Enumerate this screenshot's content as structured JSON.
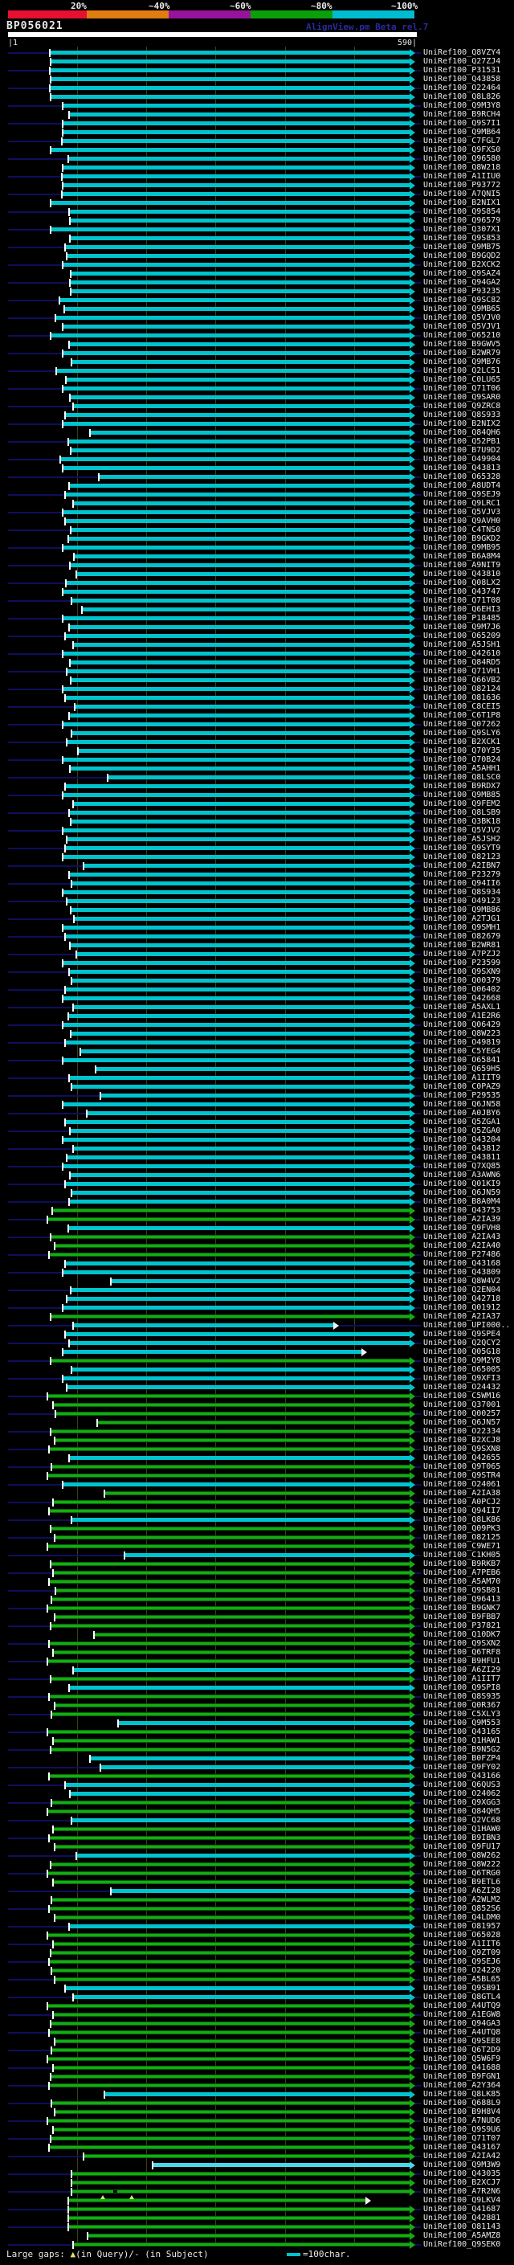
{
  "header": {
    "title": "BP056021",
    "watermark": "AlignView.pm Beta rel.7",
    "scale_labels": [
      "20%",
      "~40%",
      "~60%",
      "~80%",
      "~100%"
    ],
    "scale_colors": [
      "#e8102f",
      "#e07c10",
      "#96149b",
      "#0aa00a",
      "#00bcd0"
    ],
    "ruler_left": "|1",
    "ruler_right": "590|"
  },
  "footer": {
    "gaps_label": "Large gaps: ",
    "query_gap_symbol": "▲",
    "gaps_detail": "(in Query)/- (in Subject)",
    "scale_legend": "=100char."
  },
  "colors": {
    "cyan": "#00c3cd",
    "light_cyan": "#49d8e8",
    "green": "#14ac14",
    "green_edge": "#046504",
    "navy": "#0e0e5e",
    "grid": "#3d3d14",
    "label": "#e8e8e8",
    "yellow": "#e8e060"
  },
  "chart_data": {
    "type": "bar",
    "title": "Protein hit alignment overview for query BP056021",
    "orientation": "horizontal",
    "x_axis": {
      "label": "query position",
      "min": 1,
      "max": 590,
      "gridline_interval": 100,
      "unit": "char"
    },
    "query_length": 590,
    "identity_legend": {
      "20%": "red",
      "~40%": "orange",
      "~60%": "purple",
      "~80%": "green",
      "~100%": "cyan"
    },
    "row_format": [
      "accession",
      "color(c=cyan ~100%,g=green ~80%,C=light cyan)",
      "align_start",
      "align_end(optional,default 590)",
      "arrow(optional,o=open)"
    ],
    "rows": [
      [
        "UniRef100_Q8VZY4",
        "c",
        61
      ],
      [
        "UniRef100_Q27ZJ4",
        "c",
        62
      ],
      [
        "UniRef100_P31531",
        "c",
        61
      ],
      [
        "UniRef100_Q43858",
        "c",
        62
      ],
      [
        "UniRef100_O22464",
        "c",
        61
      ],
      [
        "UniRef100_Q8L826",
        "c",
        62
      ],
      [
        "UniRef100_Q9M3Y8",
        "c",
        80
      ],
      [
        "UniRef100_B9RCH4",
        "c",
        89
      ],
      [
        "UniRef100_Q9S7I1",
        "c",
        80
      ],
      [
        "UniRef100_Q9MB64",
        "c",
        80
      ],
      [
        "UniRef100_C7FGL7",
        "c",
        79
      ],
      [
        "UniRef100_Q9FXS0",
        "c",
        62
      ],
      [
        "UniRef100_Q96580",
        "c",
        88
      ],
      [
        "UniRef100_Q8W218",
        "c",
        80
      ],
      [
        "UniRef100_A1IIU0",
        "c",
        79
      ],
      [
        "UniRef100_P93772",
        "c",
        80
      ],
      [
        "UniRef100_A7QNI5",
        "c",
        79
      ],
      [
        "UniRef100_B2NIX1",
        "c",
        63
      ],
      [
        "UniRef100_Q9S854",
        "c",
        89
      ],
      [
        "UniRef100_Q96579",
        "c",
        90
      ],
      [
        "UniRef100_Q307X1",
        "c",
        62
      ],
      [
        "UniRef100_Q9S853",
        "c",
        91
      ],
      [
        "UniRef100_Q9MB75",
        "c",
        84
      ],
      [
        "UniRef100_B9GQD2",
        "c",
        86
      ],
      [
        "UniRef100_B2XCK2",
        "c",
        80
      ],
      [
        "UniRef100_Q9SAZ4",
        "c",
        92
      ],
      [
        "UniRef100_Q94GA2",
        "c",
        91
      ],
      [
        "UniRef100_P93235",
        "c",
        92
      ],
      [
        "UniRef100_Q9SC82",
        "c",
        75
      ],
      [
        "UniRef100_Q9MB65",
        "c",
        82
      ],
      [
        "UniRef100_Q5VJV0",
        "c",
        69
      ],
      [
        "UniRef100_Q5VJV1",
        "c",
        80
      ],
      [
        "UniRef100_O65210",
        "c",
        62
      ],
      [
        "UniRef100_B9GWV5",
        "c",
        89
      ],
      [
        "UniRef100_B2WR79",
        "c",
        80
      ],
      [
        "UniRef100_Q9MB76",
        "c",
        93
      ],
      [
        "UniRef100_Q2LC51",
        "c",
        71
      ],
      [
        "UniRef100_C0LU65",
        "c",
        85
      ],
      [
        "UniRef100_Q71T06",
        "c",
        80
      ],
      [
        "UniRef100_Q9SAR0",
        "c",
        90
      ],
      [
        "UniRef100_Q9ZRC8",
        "c",
        95
      ],
      [
        "UniRef100_Q8S933",
        "c",
        84
      ],
      [
        "UniRef100_B2NIX2",
        "c",
        80
      ],
      [
        "UniRef100_Q84QH6",
        "c",
        120
      ],
      [
        "UniRef100_Q52PB1",
        "c",
        88
      ],
      [
        "UniRef100_B7U9D2",
        "c",
        92
      ],
      [
        "UniRef100_O49904",
        "c",
        76
      ],
      [
        "UniRef100_Q43813",
        "c",
        80
      ],
      [
        "UniRef100_O65328",
        "c",
        132
      ],
      [
        "UniRef100_A8UDT4",
        "c",
        89
      ],
      [
        "UniRef100_Q9SEJ9",
        "c",
        84
      ],
      [
        "UniRef100_Q9LRC1",
        "c",
        95
      ],
      [
        "UniRef100_Q5VJV3",
        "c",
        80
      ],
      [
        "UniRef100_Q9AVH0",
        "c",
        84
      ],
      [
        "UniRef100_C4TNS0",
        "c",
        92
      ],
      [
        "UniRef100_B9GKD2",
        "c",
        88
      ],
      [
        "UniRef100_Q9MB95",
        "c",
        80
      ],
      [
        "UniRef100_B6A8M4",
        "c",
        96
      ],
      [
        "UniRef100_A9NIT9",
        "c",
        90
      ],
      [
        "UniRef100_Q43810",
        "c",
        100
      ],
      [
        "UniRef100_Q08LX2",
        "c",
        85
      ],
      [
        "UniRef100_Q43747",
        "c",
        80
      ],
      [
        "UniRef100_Q71T08",
        "c",
        93
      ],
      [
        "UniRef100_Q6EHI3",
        "c",
        108
      ],
      [
        "UniRef100_P18485",
        "c",
        80
      ],
      [
        "UniRef100_Q9M7J6",
        "c",
        89
      ],
      [
        "UniRef100_O65209",
        "c",
        84
      ],
      [
        "UniRef100_A5JSH1",
        "c",
        95
      ],
      [
        "UniRef100_Q42610",
        "c",
        80
      ],
      [
        "UniRef100_Q84RD5",
        "c",
        90
      ],
      [
        "UniRef100_Q71VH1",
        "c",
        86
      ],
      [
        "UniRef100_Q66VB2",
        "c",
        92
      ],
      [
        "UniRef100_O82124",
        "c",
        80
      ],
      [
        "UniRef100_O81636",
        "c",
        84
      ],
      [
        "UniRef100_C8CEI5",
        "c",
        98
      ],
      [
        "UniRef100_C6T1P8",
        "c",
        89
      ],
      [
        "UniRef100_Q07262",
        "c",
        80
      ],
      [
        "UniRef100_Q9SLY6",
        "c",
        93
      ],
      [
        "UniRef100_B2XCK1",
        "c",
        86
      ],
      [
        "UniRef100_Q70Y35",
        "c",
        102
      ],
      [
        "UniRef100_Q70B24",
        "c",
        80
      ],
      [
        "UniRef100_A5AHH1",
        "c",
        90
      ],
      [
        "UniRef100_Q8LSC0",
        "c",
        145
      ],
      [
        "UniRef100_B9RDX7",
        "c",
        84
      ],
      [
        "UniRef100_Q9MB85",
        "c",
        80
      ],
      [
        "UniRef100_Q9FEM2",
        "c",
        95
      ],
      [
        "UniRef100_Q8LSB9",
        "c",
        89
      ],
      [
        "UniRef100_Q3BK18",
        "c",
        92
      ],
      [
        "UniRef100_Q5VJV2",
        "c",
        80
      ],
      [
        "UniRef100_A5JSH2",
        "c",
        86
      ],
      [
        "UniRef100_Q9SYT9",
        "c",
        84
      ],
      [
        "UniRef100_O82123",
        "c",
        80
      ],
      [
        "UniRef100_A2IBN7",
        "c",
        110
      ],
      [
        "UniRef100_P23279",
        "c",
        89
      ],
      [
        "UniRef100_Q94II6",
        "c",
        93
      ],
      [
        "UniRef100_Q8S934",
        "c",
        80
      ],
      [
        "UniRef100_O49123",
        "c",
        86
      ],
      [
        "UniRef100_Q9MB86",
        "c",
        92
      ],
      [
        "UniRef100_A2TJG1",
        "c",
        96
      ],
      [
        "UniRef100_Q9SMH1",
        "c",
        80
      ],
      [
        "UniRef100_O82679",
        "c",
        84
      ],
      [
        "UniRef100_B2WR81",
        "c",
        90
      ],
      [
        "UniRef100_A7PZJ2",
        "c",
        100
      ],
      [
        "UniRef100_P23599",
        "c",
        80
      ],
      [
        "UniRef100_Q9SXN9",
        "c",
        89
      ],
      [
        "UniRef100_Q00379",
        "c",
        93
      ],
      [
        "UniRef100_Q06402",
        "c",
        84
      ],
      [
        "UniRef100_Q42668",
        "c",
        80
      ],
      [
        "UniRef100_A5AXL1",
        "c",
        95
      ],
      [
        "UniRef100_A1E2R6",
        "c",
        88
      ],
      [
        "UniRef100_Q06429",
        "c",
        80
      ],
      [
        "UniRef100_Q8W223",
        "c",
        92
      ],
      [
        "UniRef100_O49819",
        "c",
        84
      ],
      [
        "UniRef100_C5YEG4",
        "c",
        105
      ],
      [
        "UniRef100_O65841",
        "c",
        80
      ],
      [
        "UniRef100_Q659H5",
        "c",
        128
      ],
      [
        "UniRef100_A1IIT9",
        "c",
        89
      ],
      [
        "UniRef100_C0PAZ9",
        "c",
        93
      ],
      [
        "UniRef100_P29535",
        "c",
        135
      ],
      [
        "UniRef100_Q6JN58",
        "c",
        80
      ],
      [
        "UniRef100_A0JBY6",
        "c",
        115
      ],
      [
        "UniRef100_Q5ZGA1",
        "c",
        84
      ],
      [
        "UniRef100_Q5ZGA0",
        "c",
        90
      ],
      [
        "UniRef100_Q43204",
        "c",
        80
      ],
      [
        "UniRef100_Q43812",
        "c",
        95
      ],
      [
        "UniRef100_Q43811",
        "c",
        86
      ],
      [
        "UniRef100_Q7XQ85",
        "c",
        80
      ],
      [
        "UniRef100_A3AWN6",
        "c",
        90
      ],
      [
        "UniRef100_Q01KI9",
        "c",
        84
      ],
      [
        "UniRef100_Q6JN59",
        "c",
        93
      ],
      [
        "UniRef100_B8A0M4",
        "c",
        89
      ],
      [
        "UniRef100_Q43753",
        "g",
        65
      ],
      [
        "UniRef100_A2IA39",
        "g",
        58
      ],
      [
        "UniRef100_Q9FVH8",
        "c",
        88
      ],
      [
        "UniRef100_A2IA43",
        "g",
        62
      ],
      [
        "UniRef100_A2IA40",
        "g",
        68
      ],
      [
        "UniRef100_P27486",
        "g",
        60
      ],
      [
        "UniRef100_Q43168",
        "c",
        84
      ],
      [
        "UniRef100_Q43809",
        "c",
        80
      ],
      [
        "UniRef100_Q8W4V2",
        "c",
        150
      ],
      [
        "UniRef100_Q2EN04",
        "c",
        92
      ],
      [
        "UniRef100_Q42718",
        "c",
        86
      ],
      [
        "UniRef100_Q01912",
        "c",
        80
      ],
      [
        "UniRef100_A2IA37",
        "g",
        63
      ],
      [
        "UniRef100_UPI000..",
        "c",
        95,
        480,
        "o"
      ],
      [
        "UniRef100_Q9SPE4",
        "c",
        84
      ],
      [
        "UniRef100_Q2QCY2",
        "c",
        89
      ],
      [
        "UniRef100_Q05G18",
        "c",
        80,
        520,
        "o"
      ],
      [
        "UniRef100_Q9M2Y8",
        "g",
        62
      ],
      [
        "UniRef100_O65005",
        "c",
        93
      ],
      [
        "UniRef100_Q9XFI3",
        "c",
        80
      ],
      [
        "UniRef100_O24432",
        "c",
        86
      ],
      [
        "UniRef100_C5WM16",
        "g",
        58
      ],
      [
        "UniRef100_Q37001",
        "g",
        66
      ],
      [
        "UniRef100_Q00257",
        "g",
        70
      ],
      [
        "UniRef100_Q6JN57",
        "g",
        130
      ],
      [
        "UniRef100_O22334",
        "g",
        62
      ],
      [
        "UniRef100_B2XCJ8",
        "g",
        68
      ],
      [
        "UniRef100_Q9SXN8",
        "g",
        60
      ],
      [
        "UniRef100_Q42655",
        "c",
        89
      ],
      [
        "UniRef100_Q9T065",
        "g",
        64
      ],
      [
        "UniRef100_Q9STR4",
        "g",
        58
      ],
      [
        "UniRef100_O24061",
        "c",
        80
      ],
      [
        "UniRef100_A2IA38",
        "g",
        140
      ],
      [
        "UniRef100_A0PCJ2",
        "g",
        66
      ],
      [
        "UniRef100_Q94II7",
        "g",
        60
      ],
      [
        "UniRef100_Q8LK86",
        "c",
        93
      ],
      [
        "UniRef100_Q09PK3",
        "g",
        63
      ],
      [
        "UniRef100_O82125",
        "g",
        68
      ],
      [
        "UniRef100_C9WE71",
        "g",
        58
      ],
      [
        "UniRef100_C1KH05",
        "c",
        170
      ],
      [
        "UniRef100_B9RKB7",
        "g",
        62
      ],
      [
        "UniRef100_A7PEB6",
        "g",
        66
      ],
      [
        "UniRef100_A5AM70",
        "g",
        60
      ],
      [
        "UniRef100_Q9SB01",
        "g",
        70
      ],
      [
        "UniRef100_Q96413",
        "g",
        64
      ],
      [
        "UniRef100_B9GNK7",
        "g",
        58
      ],
      [
        "UniRef100_B9FBB7",
        "g",
        68
      ],
      [
        "UniRef100_P37821",
        "g",
        62
      ],
      [
        "UniRef100_Q10DK7",
        "g",
        125
      ],
      [
        "UniRef100_Q9SXN2",
        "g",
        60
      ],
      [
        "UniRef100_Q6TRF8",
        "g",
        66
      ],
      [
        "UniRef100_B9HFU1",
        "g",
        58
      ],
      [
        "UniRef100_A6ZI29",
        "c",
        95
      ],
      [
        "UniRef100_A1IIT7",
        "g",
        63
      ],
      [
        "UniRef100_Q9SPI8",
        "c",
        89
      ],
      [
        "UniRef100_Q8S935",
        "g",
        60
      ],
      [
        "UniRef100_Q0R367",
        "g",
        68
      ],
      [
        "UniRef100_C5XLY3",
        "g",
        64
      ],
      [
        "UniRef100_Q9M553",
        "c",
        160
      ],
      [
        "UniRef100_Q43165",
        "g",
        58
      ],
      [
        "UniRef100_Q1HAW1",
        "g",
        66
      ],
      [
        "UniRef100_B9N5G2",
        "g",
        62
      ],
      [
        "UniRef100_B0FZP4",
        "c",
        120
      ],
      [
        "UniRef100_Q9FY02",
        "c",
        135
      ],
      [
        "UniRef100_Q43166",
        "g",
        60
      ],
      [
        "UniRef100_Q6QUS3",
        "c",
        84
      ],
      [
        "UniRef100_O24062",
        "c",
        90
      ],
      [
        "UniRef100_Q9XGG3",
        "g",
        64
      ],
      [
        "UniRef100_Q84QH5",
        "g",
        58
      ],
      [
        "UniRef100_Q2VC68",
        "c",
        93
      ],
      [
        "UniRef100_Q1HAW0",
        "g",
        66
      ],
      [
        "UniRef100_B9IBN3",
        "g",
        60
      ],
      [
        "UniRef100_Q9FU17",
        "g",
        68
      ],
      [
        "UniRef100_Q8W262",
        "c",
        100
      ],
      [
        "UniRef100_Q8W222",
        "g",
        62
      ],
      [
        "UniRef100_Q6TRG0",
        "g",
        58
      ],
      [
        "UniRef100_B9ETL6",
        "g",
        66
      ],
      [
        "UniRef100_A6ZI28",
        "c",
        150
      ],
      [
        "UniRef100_A2WLM2",
        "g",
        64
      ],
      [
        "UniRef100_Q852S6",
        "g",
        60
      ],
      [
        "UniRef100_Q4LDM0",
        "g",
        68
      ],
      [
        "UniRef100_O81957",
        "c",
        89
      ],
      [
        "UniRef100_O65028",
        "g",
        58
      ],
      [
        "UniRef100_A1IIT6",
        "g",
        66
      ],
      [
        "UniRef100_Q9ZT09",
        "g",
        62
      ],
      [
        "UniRef100_Q9SEJ6",
        "g",
        60
      ],
      [
        "UniRef100_O24220",
        "g",
        64
      ],
      [
        "UniRef100_A5BL65",
        "g",
        68
      ],
      [
        "UniRef100_Q9SB91",
        "c",
        84
      ],
      [
        "UniRef100_Q8GTL4",
        "c",
        95
      ],
      [
        "UniRef100_A4UTQ9",
        "g",
        58
      ],
      [
        "UniRef100_A1EGW8",
        "g",
        66
      ],
      [
        "UniRef100_Q94GA3",
        "g",
        62
      ],
      [
        "UniRef100_A4UTQ8",
        "g",
        60
      ],
      [
        "UniRef100_Q9SEE8",
        "g",
        68
      ],
      [
        "UniRef100_Q6T2D9",
        "g",
        64
      ],
      [
        "UniRef100_Q5W6F9",
        "g",
        58
      ],
      [
        "UniRef100_Q41688",
        "g",
        66
      ],
      [
        "UniRef100_B9FGN1",
        "g",
        62
      ],
      [
        "UniRef100_A2Y364",
        "g",
        60
      ],
      [
        "UniRef100_Q8LK85",
        "c",
        140
      ],
      [
        "UniRef100_Q688L9",
        "g",
        64
      ],
      [
        "UniRef100_B9H8V4",
        "g",
        68
      ],
      [
        "UniRef100_A7NUD6",
        "g",
        58
      ],
      [
        "UniRef100_Q9S9U6",
        "g",
        66
      ],
      [
        "UniRef100_Q71T07",
        "g",
        62
      ],
      [
        "UniRef100_Q43167",
        "g",
        60
      ],
      [
        "UniRef100_A2IA42",
        "g",
        110
      ],
      [
        "UniRef100_Q9M3W9",
        "C",
        210
      ],
      [
        "UniRef100_Q43035",
        "g",
        93
      ],
      [
        "UniRef100_B2XCJ7",
        "g",
        93
      ],
      [
        "UniRef100_A7R2N6",
        "g",
        93
      ],
      [
        "UniRef100_Q9LKV4",
        "g",
        88,
        526,
        "o"
      ],
      [
        "UniRef100_Q41687",
        "g",
        88
      ],
      [
        "UniRef100_Q42881",
        "g",
        88
      ],
      [
        "UniRef100_O81143",
        "g",
        88
      ],
      [
        "UniRef100_A5AMZ8",
        "g",
        116
      ],
      [
        "UniRef100_Q9SEK0",
        "g",
        95
      ]
    ],
    "markers": {
      "243": {
        "subject_gap": [
          155
        ]
      },
      "244": {
        "query_gap": [
          138,
          180
        ]
      }
    }
  }
}
